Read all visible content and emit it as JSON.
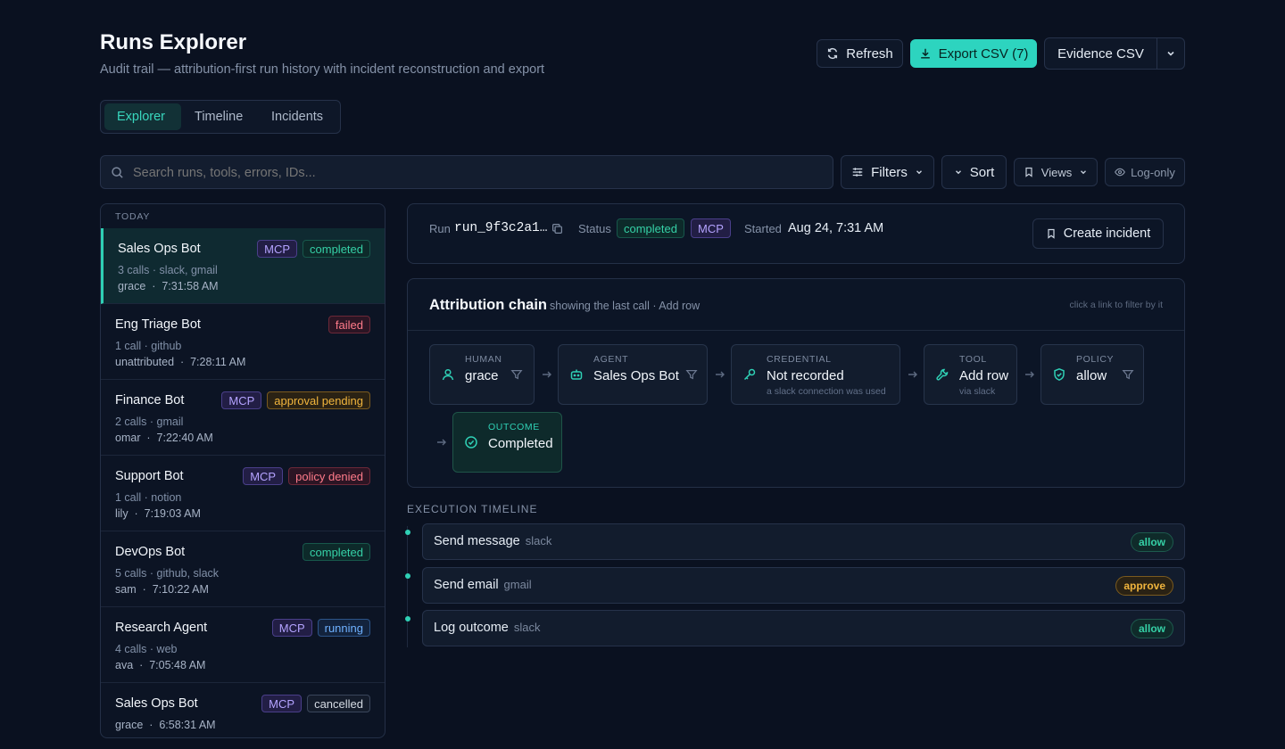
{
  "header": {
    "title": "Runs Explorer",
    "subtitle": "Audit trail — attribution-first run history with incident reconstruction and export",
    "refresh_label": "Refresh",
    "export_label": "Export CSV (7)",
    "evidence_label": "Evidence CSV"
  },
  "tabs": [
    {
      "label": "Explorer",
      "active": true
    },
    {
      "label": "Timeline",
      "active": false
    },
    {
      "label": "Incidents",
      "active": false
    }
  ],
  "toolbar": {
    "search_placeholder": "Search runs, tools, errors, IDs...",
    "filters_label": "Filters",
    "sort_label": "Sort",
    "views_label": "Views",
    "logonly_label": "Log-only"
  },
  "runs": {
    "section_label": "TODAY",
    "items": [
      {
        "name": "Sales Ops Bot",
        "meta": "3 calls · slack, gmail",
        "who": "grace",
        "time": "7:31:58 AM",
        "mcp": "MCP",
        "status": "completed"
      },
      {
        "name": "Eng Triage Bot",
        "meta": "1 call · github",
        "who": "unattributed",
        "time": "7:28:11 AM",
        "mcp": "",
        "status": "failed"
      },
      {
        "name": "Finance Bot",
        "meta": "2 calls · gmail",
        "who": "omar",
        "time": "7:22:40 AM",
        "mcp": "MCP",
        "status": "approval pending"
      },
      {
        "name": "Support Bot",
        "meta": "1 call · notion",
        "who": "lily",
        "time": "7:19:03 AM",
        "mcp": "MCP",
        "status": "policy denied"
      },
      {
        "name": "DevOps Bot",
        "meta": "5 calls · github, slack",
        "who": "sam",
        "time": "7:10:22 AM",
        "mcp": "",
        "status": "completed"
      },
      {
        "name": "Research Agent",
        "meta": "4 calls · web",
        "who": "ava",
        "time": "7:05:48 AM",
        "mcp": "MCP",
        "status": "running"
      },
      {
        "name": "Sales Ops Bot",
        "meta": "",
        "who": "grace",
        "time": "6:58:31 AM",
        "mcp": "MCP",
        "status": "cancelled"
      }
    ]
  },
  "detail": {
    "run_label": "Run",
    "run_id": "run_9f3c2a1…",
    "status_label": "Status",
    "status": "completed",
    "mcp": "MCP",
    "started_label": "Started",
    "started": "Aug 24, 7:31 AM",
    "create_incident_label": "Create incident"
  },
  "chain": {
    "title": "Attribution chain",
    "subtitle": "showing the last call · Add row",
    "hint": "click a link to filter by it",
    "human": {
      "label": "HUMAN",
      "value": "grace"
    },
    "agent": {
      "label": "AGENT",
      "value": "Sales Ops Bot"
    },
    "credential": {
      "label": "CREDENTIAL",
      "value": "Not recorded",
      "sub": "a slack connection was used"
    },
    "tool": {
      "label": "TOOL",
      "value": "Add row",
      "sub": "via slack"
    },
    "policy": {
      "label": "POLICY",
      "value": "allow"
    },
    "outcome": {
      "label": "OUTCOME",
      "value": "Completed"
    }
  },
  "timeline": {
    "title": "EXECUTION TIMELINE",
    "rows": [
      {
        "title": "Send message",
        "tool": "slack",
        "decision": "allow"
      },
      {
        "title": "Send email",
        "tool": "gmail",
        "decision": "approve"
      },
      {
        "title": "Log outcome",
        "tool": "slack",
        "decision": "allow"
      }
    ]
  },
  "colors": {
    "accent": "#2fd0b5",
    "background": "#0a1120"
  }
}
